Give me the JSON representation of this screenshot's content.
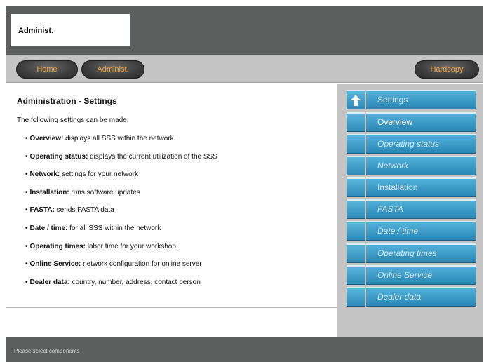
{
  "header": {
    "title": "Administ."
  },
  "nav": {
    "home": "Home",
    "admin": "Administ.",
    "hardcopy": "Hardcopy"
  },
  "content": {
    "title": "Administration - Settings",
    "intro": "The following settings can be made:",
    "items": [
      {
        "term": "Overview:",
        "desc": " displays all SSS within the network."
      },
      {
        "term": "Operating status:",
        "desc": " displays the current utilization of the SSS"
      },
      {
        "term": "Network:",
        "desc": " settings for your network"
      },
      {
        "term": "Installation:",
        "desc": " runs software updates"
      },
      {
        "term": "FASTA:",
        "desc": " sends FASTA data"
      },
      {
        "term": "Date / time:",
        "desc": " for all SSS within the network"
      },
      {
        "term": "Operating times:",
        "desc": " labor time for your workshop"
      },
      {
        "term": "Online Service:",
        "desc": " network configuration for online server"
      },
      {
        "term": "Dealer data:",
        "desc": " country, number, address, contact person"
      }
    ]
  },
  "menu": {
    "items": [
      {
        "label": "Settings",
        "style": "normal",
        "icon": "up-arrow-icon"
      },
      {
        "label": "Overview",
        "style": "active"
      },
      {
        "label": "Operating status",
        "style": "italic"
      },
      {
        "label": "Network",
        "style": "italic"
      },
      {
        "label": "Installation",
        "style": "normal"
      },
      {
        "label": "FASTA",
        "style": "italic"
      },
      {
        "label": "Date / time",
        "style": "italic"
      },
      {
        "label": "Operating times",
        "style": "italic"
      },
      {
        "label": "Online Service",
        "style": "italic"
      },
      {
        "label": "Dealer data",
        "style": "italic"
      }
    ]
  },
  "status": {
    "text": "Please select components"
  },
  "colors": {
    "accent_orange": "#f0a63a",
    "menu_blue": "#3d9fcc",
    "frame_gray": "#5d5f5e",
    "panel_gray": "#c4c4c4"
  }
}
